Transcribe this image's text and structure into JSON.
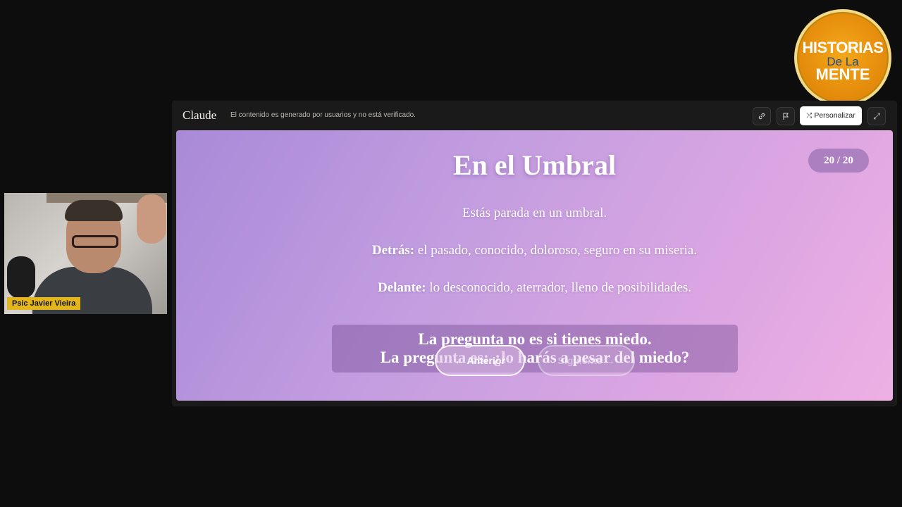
{
  "webcam": {
    "name_label": "Psic Javier Vieira"
  },
  "logo": {
    "line1": "HISTORIAS",
    "line2": "De La",
    "line3": "MENTE"
  },
  "topbar": {
    "brand": "Claude",
    "notice": "El contenido es generado por usuarios y no está verificado.",
    "personalize_label": "Personalizar",
    "icons": [
      "link-icon",
      "flag-icon",
      "shuffle-icon",
      "expand-icon"
    ]
  },
  "slide": {
    "title": "En el Umbral",
    "counter": "20 / 20",
    "intro": "Estás parada en un umbral.",
    "behind_label": "Detrás:",
    "behind_text": " el pasado, conocido, doloroso, seguro en su miseria.",
    "ahead_label": "Delante:",
    "ahead_text": " lo desconocido, aterrador, lleno de posibilidades.",
    "question_line1": "La pregunta no es si tienes miedo.",
    "question_line2": "La pregunta es: ¿lo harás a pesar del miedo?",
    "prev_label": "← Anterior",
    "next_label": "Siguiente →"
  },
  "colors": {
    "slide_gradient_start": "#a98ad8",
    "slide_gradient_end": "#eeb0e4",
    "name_tag": "#e2b61c",
    "logo_orange": "#e58c0c"
  }
}
